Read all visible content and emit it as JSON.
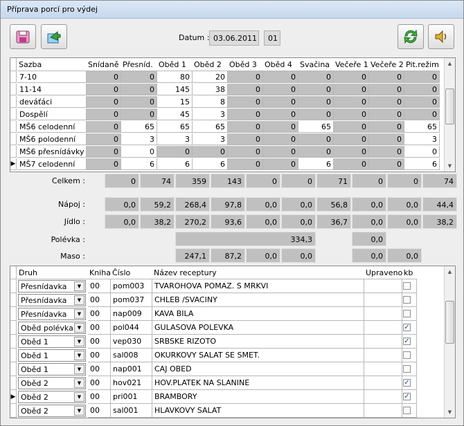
{
  "window": {
    "title": "Příprava porcí pro výdej"
  },
  "toolbar": {
    "datum_label": "Datum :",
    "datum_value": "03.06.2011",
    "code_value": "01"
  },
  "colors": {
    "grey_cell": "#c0c0c0",
    "title_bar": "#c6d8ee"
  },
  "icons": [
    "save-disk-icon",
    "export-arrow-icon",
    "refresh-icon",
    "speaker-icon"
  ],
  "portions": {
    "headers": [
      "Sazba",
      "Snídaně",
      "Přesníd.",
      "Oběd 1",
      "Oběd 2",
      "Oběd 3",
      "Oběd 4",
      "Svačina",
      "Večeře 1",
      "Večeře 2",
      "Pit.režim"
    ],
    "rows": [
      {
        "name": "7-10",
        "values": [
          "0",
          "0",
          "80",
          "20",
          "0",
          "0",
          "0",
          "0",
          "0",
          "0"
        ]
      },
      {
        "name": "11-14",
        "values": [
          "0",
          "0",
          "145",
          "38",
          "0",
          "0",
          "0",
          "0",
          "0",
          "0"
        ]
      },
      {
        "name": "deváťáci",
        "values": [
          "0",
          "0",
          "15",
          "8",
          "0",
          "0",
          "0",
          "0",
          "0",
          "0"
        ]
      },
      {
        "name": "Dospělí",
        "values": [
          "0",
          "0",
          "45",
          "3",
          "0",
          "0",
          "0",
          "0",
          "0",
          "0"
        ]
      },
      {
        "name": "MŠ6 celodenní",
        "values": [
          "0",
          "65",
          "65",
          "65",
          "0",
          "0",
          "65",
          "0",
          "0",
          "65"
        ]
      },
      {
        "name": "MŠ6 polodenní",
        "values": [
          "0",
          "3",
          "3",
          "3",
          "0",
          "0",
          "0",
          "0",
          "0",
          "3"
        ]
      },
      {
        "name": "MŠ6 přesnídávky",
        "values": [
          "0",
          "0",
          "0",
          "0",
          "0",
          "0",
          "0",
          "0",
          "0",
          "0"
        ]
      },
      {
        "name": "MŠ7 celodenní",
        "values": [
          "0",
          "6",
          "6",
          "6",
          "0",
          "0",
          "6",
          "0",
          "0",
          "6"
        ]
      }
    ],
    "white_pattern": [
      [
        0,
        0,
        1,
        1,
        0,
        0,
        0,
        0,
        0,
        0
      ],
      [
        0,
        0,
        1,
        1,
        0,
        0,
        0,
        0,
        0,
        0
      ],
      [
        0,
        0,
        1,
        1,
        0,
        0,
        0,
        0,
        0,
        0
      ],
      [
        0,
        0,
        1,
        1,
        0,
        0,
        0,
        0,
        0,
        0
      ],
      [
        0,
        1,
        1,
        1,
        0,
        0,
        1,
        0,
        0,
        1
      ],
      [
        0,
        1,
        1,
        1,
        0,
        0,
        0,
        0,
        0,
        1
      ],
      [
        0,
        1,
        0,
        0,
        0,
        0,
        0,
        0,
        0,
        1
      ],
      [
        0,
        1,
        1,
        1,
        0,
        0,
        1,
        0,
        0,
        1
      ]
    ]
  },
  "summary": {
    "celkem_label": "Celkem :",
    "celkem": [
      "0",
      "74",
      "359",
      "143",
      "0",
      "0",
      "71",
      "0",
      "0",
      "74"
    ],
    "napoj_label": "Nápoj :",
    "napoj": [
      "0,0",
      "59,2",
      "268,4",
      "97,8",
      "0,0",
      "0,0",
      "56,8",
      "0,0",
      "0,0",
      "44,4"
    ],
    "jidlo_label": "Jídlo :",
    "jidlo": [
      "0,0",
      "38,2",
      "270,2",
      "93,6",
      "0,0",
      "0,0",
      "36,7",
      "0,0",
      "0,0",
      "38,2"
    ],
    "polevka_label": "Polévka :",
    "polevka_main": "334,3",
    "polevka_vecere": "0,0",
    "maso_label": "Maso :",
    "maso": [
      "247,1",
      "87,2",
      "0,0",
      "0,0"
    ],
    "maso_vecere": [
      "0,0",
      "0,0"
    ]
  },
  "recipes": {
    "headers": {
      "druh": "Druh",
      "kniha": "Kniha",
      "cislo": "Číslo",
      "nazev": "Název receptury",
      "upraveno": "Upraveno",
      "kb": "kb"
    },
    "rows": [
      {
        "druh": "Přesnídavka",
        "kniha": "00",
        "cislo": "pom003",
        "nazev": "TVAROHOVA POMAZ. S MRKVI",
        "kb": false
      },
      {
        "druh": "Přesnídavka",
        "kniha": "00",
        "cislo": "pom037",
        "nazev": " CHLEB  /SVACINY",
        "kb": false
      },
      {
        "druh": "Přesnídavka",
        "kniha": "00",
        "cislo": "nap009",
        "nazev": "KAVA BILA",
        "kb": false
      },
      {
        "druh": "Oběd polévka",
        "kniha": "00",
        "cislo": "pol044",
        "nazev": "GULASOVA POLEVKA",
        "kb": true
      },
      {
        "druh": "Oběd 1",
        "kniha": "00",
        "cislo": "vep030",
        "nazev": "SRBSKE RIZOTO",
        "kb": true
      },
      {
        "druh": "Oběd 1",
        "kniha": "00",
        "cislo": "sal008",
        "nazev": "OKURKOVY SALAT SE SMET.",
        "kb": false
      },
      {
        "druh": "Oběd 1",
        "kniha": "00",
        "cislo": "nap001",
        "nazev": "CAJ OBED",
        "kb": false
      },
      {
        "druh": "Oběd 2",
        "kniha": "00",
        "cislo": "hov021",
        "nazev": "HOV.PLATEK NA SLANINE",
        "kb": true
      },
      {
        "druh": "Oběd 2",
        "kniha": "00",
        "cislo": "pri001",
        "nazev": "BRAMBORY",
        "kb": true
      },
      {
        "druh": "Oběd 2",
        "kniha": "00",
        "cislo": "sal001",
        "nazev": "HLAVKOVY SALAT",
        "kb": false
      }
    ]
  }
}
